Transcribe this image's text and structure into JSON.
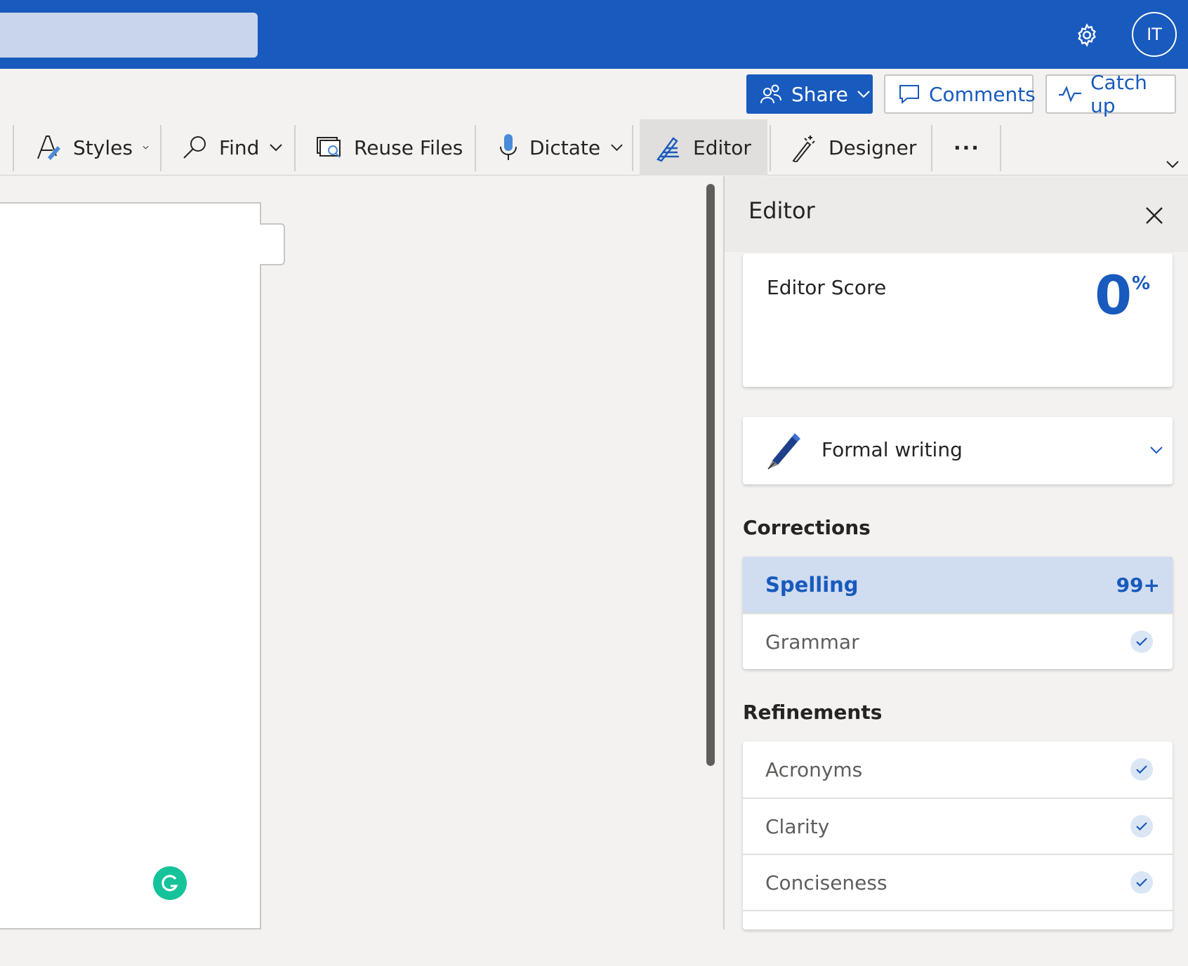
{
  "header": {
    "search_placeholder": "",
    "avatar_initials": "IT"
  },
  "actions": {
    "share": "Share",
    "comments": "Comments",
    "catch_up": "Catch up"
  },
  "ribbon": {
    "styles": "Styles",
    "find": "Find",
    "reuse_files": "Reuse Files",
    "dictate": "Dictate",
    "editor": "Editor",
    "designer": "Designer",
    "more": "···"
  },
  "editor_pane": {
    "title": "Editor",
    "score_label": "Editor Score",
    "score_value": "0",
    "score_unit": "%",
    "writing_style": "Formal writing",
    "corrections_title": "Corrections",
    "corrections": [
      {
        "label": "Spelling",
        "count": "99+"
      },
      {
        "label": "Grammar"
      }
    ],
    "refinements_title": "Refinements",
    "refinements": [
      {
        "label": "Acronyms"
      },
      {
        "label": "Clarity"
      },
      {
        "label": "Conciseness"
      }
    ]
  },
  "colors": {
    "brand_blue": "#185abd",
    "grammarly_green": "#15c39a"
  }
}
